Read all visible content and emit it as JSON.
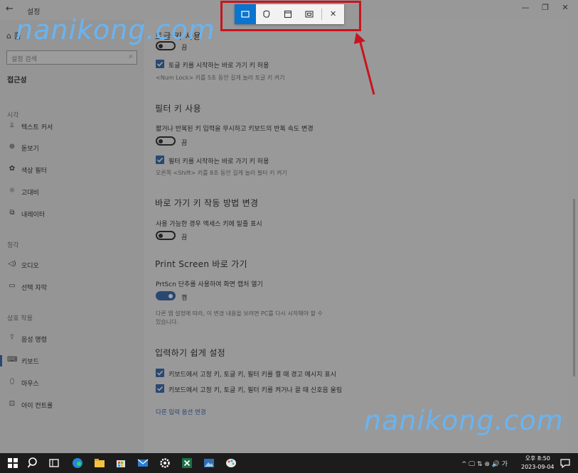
{
  "window": {
    "title": "설정",
    "back_glyph": "←",
    "minimize_glyph": "—",
    "restore_glyph": "❐",
    "close_glyph": "✕"
  },
  "sidebar": {
    "home_label": "홈",
    "search_placeholder": "설정 검색",
    "heading": "접근성",
    "groups": {
      "vision": "시각",
      "hearing": "청각",
      "interaction": "상호 작용"
    },
    "items": [
      {
        "label": "텍스트 커서",
        "icon": "text-cursor-icon",
        "glyph": "⫫"
      },
      {
        "label": "돋보기",
        "icon": "magnifier-icon",
        "glyph": "⊕"
      },
      {
        "label": "색상 필터",
        "icon": "color-filter-icon",
        "glyph": "✿"
      },
      {
        "label": "고대비",
        "icon": "high-contrast-icon",
        "glyph": "☼"
      },
      {
        "label": "내레이터",
        "icon": "narrator-icon",
        "glyph": "⧉"
      },
      {
        "label": "오디오",
        "icon": "audio-icon",
        "glyph": "◁)"
      },
      {
        "label": "선택 자막",
        "icon": "captions-icon",
        "glyph": "▭"
      },
      {
        "label": "음성 명령",
        "icon": "microphone-icon",
        "glyph": "⍢"
      },
      {
        "label": "키보드",
        "icon": "keyboard-icon",
        "glyph": "⌨"
      },
      {
        "label": "마우스",
        "icon": "mouse-icon",
        "glyph": "⬯"
      },
      {
        "label": "아이 컨트롤",
        "icon": "eye-control-icon",
        "glyph": "⊡"
      }
    ]
  },
  "content": {
    "toggle_keys_partial_heading": "토글 키 사용",
    "toggle_keys_state": "끔",
    "toggle_keys_shortcut_label": "토글 키를 시작하는 바로 가기 키 허용",
    "toggle_keys_shortcut_note": "<Num Lock> 키를 5초 동안 길게 눌러 토글 키 켜기",
    "filter_heading": "필터 키 사용",
    "filter_desc": "짧거나 반복된 키 입력을 무시하고 키보드의 반복 속도 변경",
    "filter_state": "끔",
    "filter_shortcut_label": "필터 키를 시작하는 바로 가기 키 허용",
    "filter_shortcut_note": "오른쪽 <Shift> 키를 8초 동안 길게 눌러 필터 키 켜기",
    "shortcut_heading": "바로 가기 키 작동 방법 변경",
    "shortcut_desc": "사용 가능한 경우 액세스 키에 밑줄 표시",
    "shortcut_state": "끔",
    "prtscn_heading": "Print Screen 바로 가기",
    "prtscn_desc": "PrtScn 단추를 사용하여 화면 캡처 열기",
    "prtscn_state": "켬",
    "prtscn_note_1": "다른 앱 설정에 따라, 이 변경 내용을 보려면 PC를 다시 시작해야 할 수",
    "prtscn_note_2": "있습니다.",
    "easy_heading": "입력하기 쉽게 설정",
    "easy_check_1": "키보드에서 고정 키, 토글 키, 필터 키를 켤 때 경고 메시지 표시",
    "easy_check_2": "키보드에서 고정 키, 토글 키, 필터 키를 켜거나 끌 때 신호음 울림",
    "other_link": "다른 입력 옵션 변경"
  },
  "snip_toolbar": {
    "buttons": [
      {
        "name": "rectangular-snip-icon",
        "active": true
      },
      {
        "name": "freeform-snip-icon",
        "active": false
      },
      {
        "name": "window-snip-icon",
        "active": false
      },
      {
        "name": "fullscreen-snip-icon",
        "active": false
      }
    ],
    "close_glyph": "✕"
  },
  "watermark": "nanikong.com",
  "taskbar": {
    "time": "오후 8:50",
    "date": "2023-09-04",
    "tray_glyphs": "^ 🖵 ⇅ ⊗ 🔊 가"
  },
  "colors": {
    "accent": "#2b5fa6",
    "snip_active": "#0a74d1",
    "highlight": "#c8141e",
    "watermark": "#6ab4f0"
  }
}
